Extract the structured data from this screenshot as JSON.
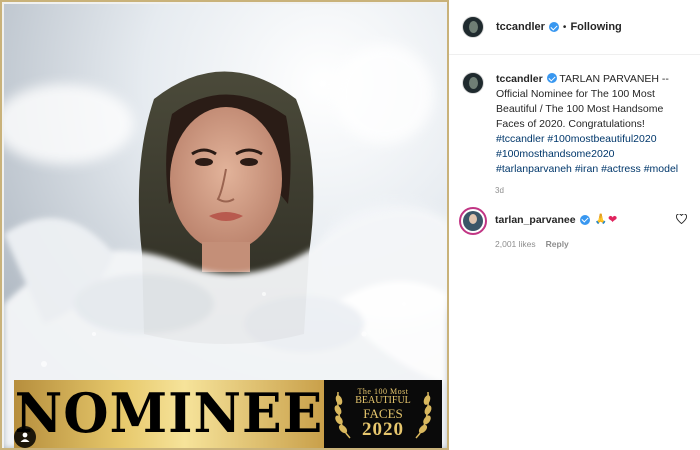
{
  "post": {
    "author": "tccandler",
    "follow_status": "Following",
    "separator": "•",
    "caption_intro": "TARLAN PARVANEH -- Official Nominee for The 100 Most Beautiful / The 100 Most Handsome Faces of 2020. Congratulations!",
    "hashtags": [
      "#tccandler",
      "#100mostbeautiful2020",
      "#100mosthandsome2020",
      "#tarlanparvaneh",
      "#iran",
      "#actress",
      "#model"
    ],
    "age": "3d"
  },
  "image": {
    "banner_word": "NOMINEE",
    "award_line1": "The 100 Most",
    "award_line2": "BEAUTIFUL",
    "award_line3": "FACES",
    "award_line4": "2020"
  },
  "comment": {
    "author": "tarlan_parvanee",
    "emojis": "🙏",
    "heart": "❤",
    "likes": "2,001 likes",
    "reply": "Reply"
  },
  "icons": {
    "verified": "verified-badge-icon",
    "user_tag": "user-tag-icon",
    "like": "heart-outline-icon"
  },
  "colors": {
    "verified_blue": "#3897f0",
    "hashtag_blue": "#00376b",
    "gold": "#e7c96c",
    "story_ring": "#c13584"
  }
}
